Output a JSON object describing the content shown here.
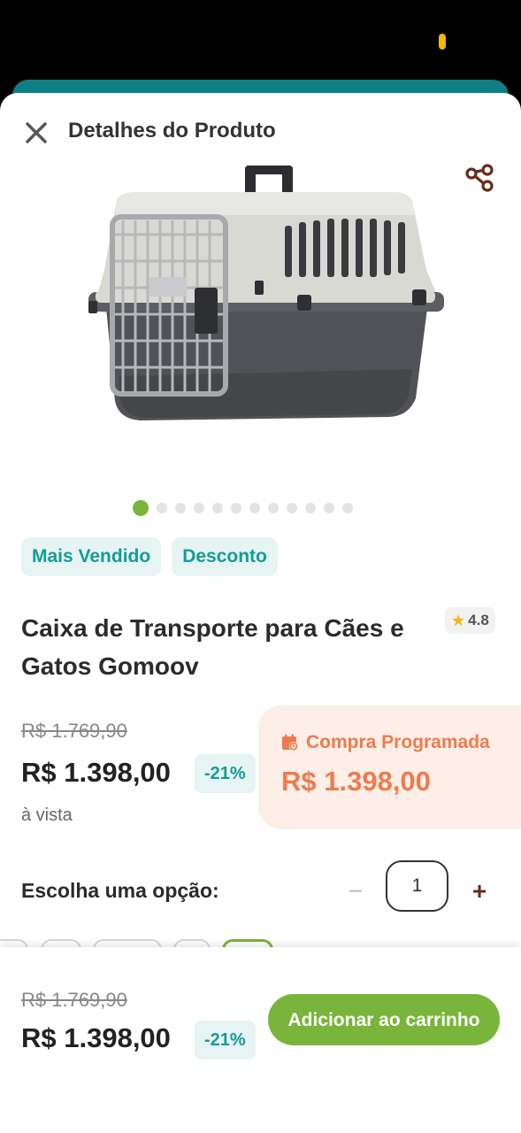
{
  "header": {
    "title": "Detalhes do Produto"
  },
  "product": {
    "title": "Caixa de Transporte para Cães e Gatos Gomoov",
    "rating": "4.8",
    "tags": [
      "Mais Vendido",
      "Desconto"
    ],
    "old_price": "R$ 1.769,90",
    "price": "R$ 1.398,00",
    "discount": "-21%",
    "payment_note": "à vista"
  },
  "carousel": {
    "total": 12,
    "active_index": 0
  },
  "scheduled": {
    "label": "Compra Programada",
    "price": "R$ 1.398,00"
  },
  "options": {
    "label": "Escolha uma opção:",
    "quantity": "1",
    "minus": "−",
    "plus": "+"
  },
  "bottom_bar": {
    "old_price": "R$ 1.769,90",
    "price": "R$ 1.398,00",
    "discount": "-21%",
    "add_to_cart": "Adicionar ao carrinho"
  },
  "colors": {
    "green": "#78b53a",
    "teal": "#159c97",
    "orange": "#ee7b4e",
    "dark_teal": "#0e7f84"
  },
  "icons": [
    "close-icon",
    "share-icon",
    "star-icon",
    "calendar-icon"
  ]
}
